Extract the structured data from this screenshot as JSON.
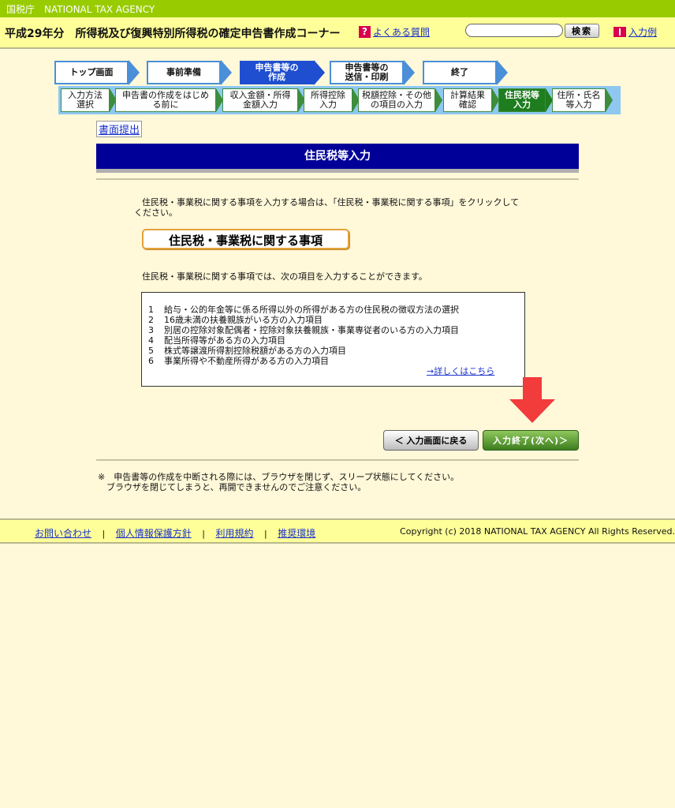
{
  "agency_name": "国税庁　NATIONAL TAX AGENCY",
  "header": {
    "title": "平成29年分　所得税及び復興特別所得税の確定申告書作成コーナー",
    "faq_icon": "?",
    "faq_label": "よくある質問",
    "search_button": "検索",
    "input_example": "入力例"
  },
  "steps": [
    "トップ画面",
    "事前準備",
    "申告書等の\n作成",
    "申告書等の\n送信・印刷",
    "終了"
  ],
  "substeps": [
    "入力方法\n選択",
    "申告書の作成をはじめ\nる前に",
    "収入金額・所得\n金額入力",
    "所得控除\n入力",
    "税額控除・その他\nの項目の入力",
    "計算結果\n確認",
    "住民税等\n入力",
    "住所・氏名\n等入力"
  ],
  "submit_link": "書面提出",
  "section_title": "住民税等入力",
  "intro_line1": "住民税・事業税に関する事項を入力する場合は、「住民税・事業税に関する事項」をクリックして",
  "intro_line2": "ください。",
  "main_button": "住民税・事業税に関する事項",
  "list_intro": "住民税・事業税に関する事項では、次の項目を入力することができます。",
  "items": [
    {
      "num": "1",
      "text": "給与・公的年金等に係る所得以外の所得がある方の住民税の徴収方法の選択"
    },
    {
      "num": "2",
      "text": "16歳未満の扶養親族がいる方の入力項目"
    },
    {
      "num": "3",
      "text": "別居の控除対象配偶者・控除対象扶養親族・事業専従者のいる方の入力項目"
    },
    {
      "num": "4",
      "text": "配当所得等がある方の入力項目"
    },
    {
      "num": "5",
      "text": "株式等譲渡所得割控除税額がある方の入力項目"
    },
    {
      "num": "6",
      "text": "事業所得や不動産所得がある方の入力項目"
    }
  ],
  "details_link": "→詳しくはこちら",
  "buttons": {
    "back": "＜ 入力画面に戻る",
    "next": "入力終了(次へ)＞"
  },
  "note_line1": "※　申告書等の作成を中断される際には、ブラウザを閉じず、スリープ状態にしてください。",
  "note_line2": "ブラウザを閉じてしまうと、再開できませんのでご注意ください。",
  "footer": {
    "links": [
      "お問い合わせ",
      "個人情報保護方針",
      "利用規約",
      "推奨環境"
    ],
    "separator": "|",
    "copyright": "Copyright (c) 2018 NATIONAL TAX AGENCY All Rights Reserved."
  },
  "colors": {
    "agency_bar": "#99cc00",
    "header_bg": "#ffff99",
    "section_header": "#000099",
    "active_step": "#1f4fd0",
    "active_substep": "#1e7d1e",
    "arrow_red": "#f23b3b"
  }
}
